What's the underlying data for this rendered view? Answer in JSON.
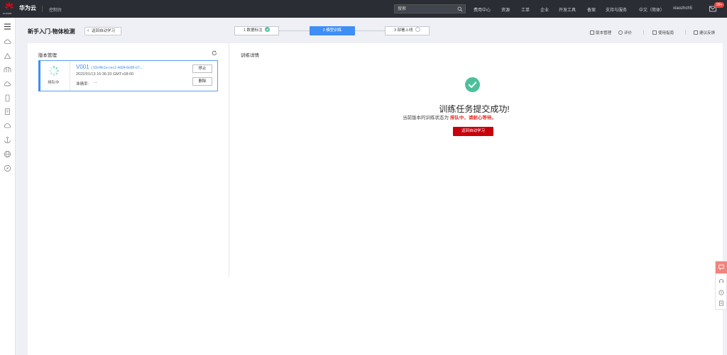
{
  "topbar": {
    "logo_text": "HUAWEI",
    "brand": "华为云",
    "console": "控制台",
    "search_placeholder": "搜索",
    "nav": [
      "费用中心",
      "资源",
      "工单",
      "企业",
      "开发工具",
      "备案",
      "支持与服务",
      "中文（简体）",
      "xiaozhch5"
    ],
    "badge": "99+"
  },
  "sidebar": {
    "icons": [
      "menu-icon",
      "cloud-server-icon",
      "cloud-icon",
      "bridge-icon",
      "cloud-storage-icon",
      "mobile-icon",
      "document-icon",
      "cloud-outline-icon",
      "anchor-icon",
      "globe-icon",
      "compass-icon"
    ]
  },
  "header": {
    "title": "新手入门-物体检测",
    "back_label": "返回自动学习",
    "steps": [
      {
        "label": "1 数据标注",
        "state": "done"
      },
      {
        "label": "2 模型训练",
        "state": "active"
      },
      {
        "label": "3 部署上线",
        "state": "pending"
      }
    ],
    "tools": {
      "version_mgmt": "版本管理",
      "rate": "评价",
      "guide": "使用指南",
      "feedback": "建议反馈"
    }
  },
  "left": {
    "title": "版本管理",
    "version": {
      "name": "V001",
      "id": "( 93c4fe1e-cec1-4d94-8e86-b7...",
      "time": "2022/01/13 16:36:33 GMT+08:00",
      "accuracy_label": "准确率:",
      "accuracy_value": "--",
      "status": "排队中",
      "stop": "停止",
      "delete": "删除"
    }
  },
  "right": {
    "title": "训练详情",
    "success_title": "训练任务提交成功!",
    "sub_prefix": "当前版本的训练状态为",
    "sub_highlight": "排队中，请耐心等待。",
    "back_button": "返回自动学习"
  },
  "colors": {
    "accent": "#3f8ef5",
    "success": "#4cbf9b",
    "danger": "#c7000b",
    "topbar": "#2a2d33"
  }
}
